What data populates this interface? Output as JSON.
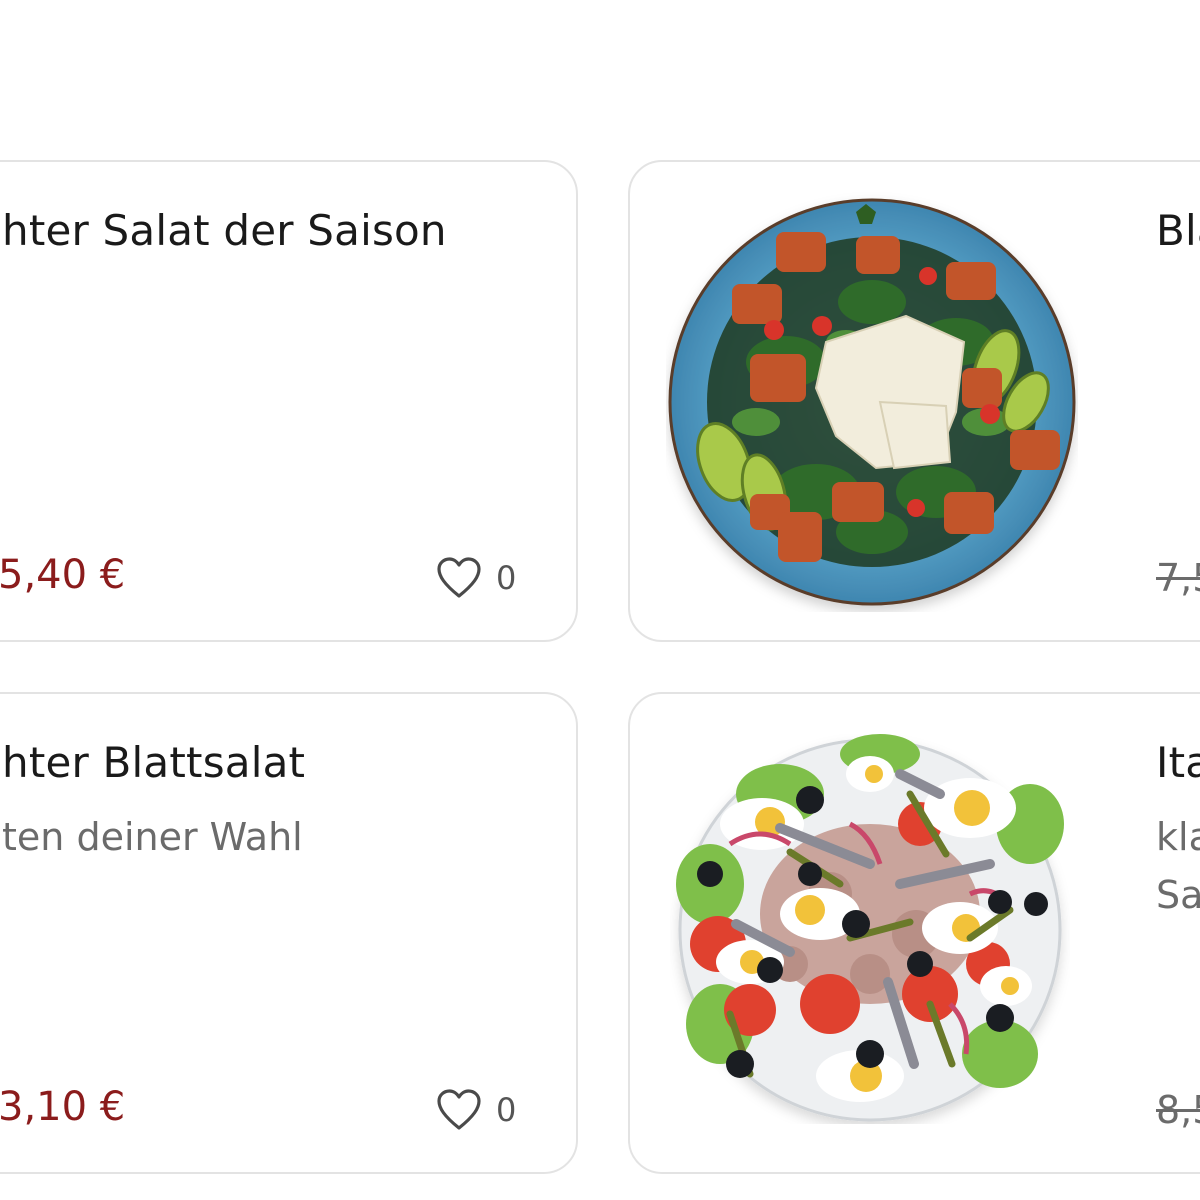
{
  "cards": [
    {
      "title": "hter Salat der Saison",
      "description": "",
      "price": "5,40 €",
      "likes": "0"
    },
    {
      "title": "Bla",
      "price_old": "7,5",
      "image": "salad-plate-chicken-avocado-parmesan"
    },
    {
      "title": "hter Blattsalat",
      "description": "ten deiner Wahl",
      "price": "3,10 €",
      "likes": "0"
    },
    {
      "title": "Ita",
      "description_line1": "kla",
      "description_line2": "Sa",
      "price_old": "8,5",
      "image": "salad-nicoise-plate"
    }
  ],
  "colors": {
    "price": "#8b1c1c",
    "border": "#e3e3e3",
    "text": "#1a1a1a",
    "muted": "#6b6b6b"
  },
  "icons": {
    "like": "heart-outline-icon"
  }
}
